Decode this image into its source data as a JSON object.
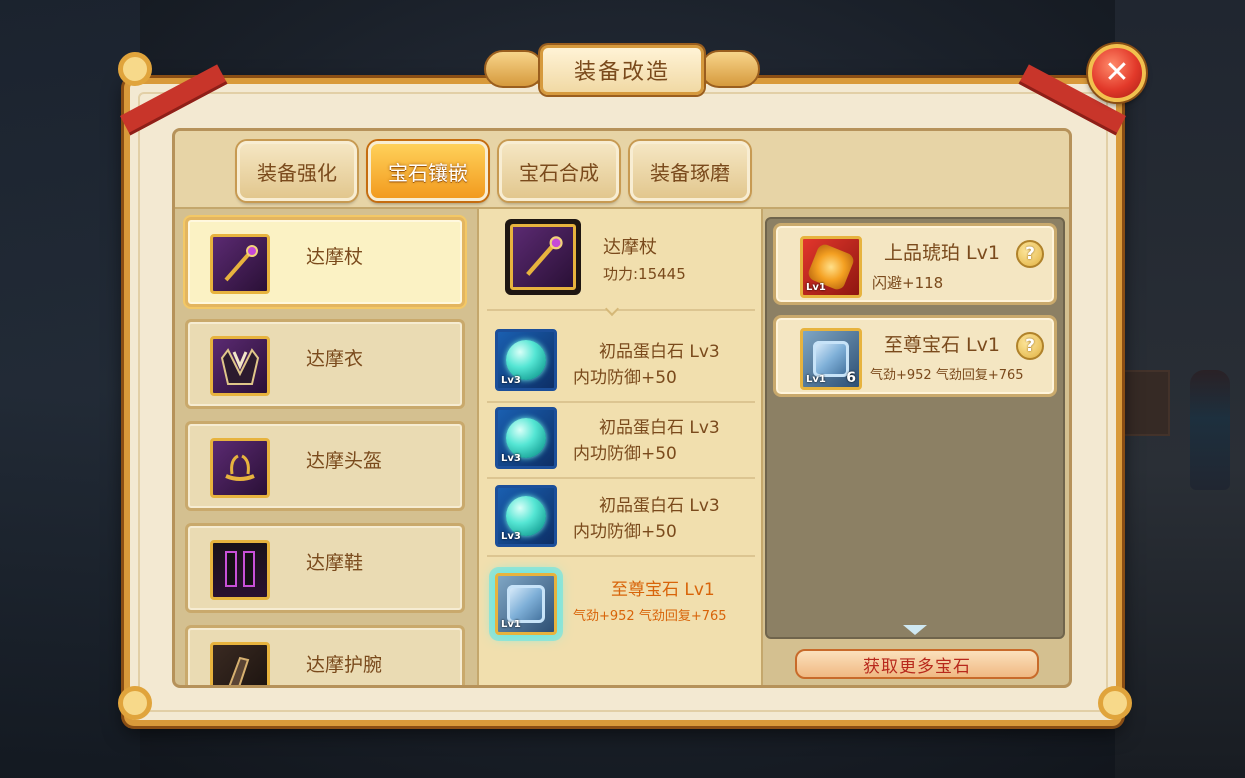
{
  "title": "装备改造",
  "close_label": "✕",
  "tabs": [
    {
      "label": "装备强化",
      "active": false
    },
    {
      "label": "宝石镶嵌",
      "active": true
    },
    {
      "label": "宝石合成",
      "active": false
    },
    {
      "label": "装备琢磨",
      "active": false
    }
  ],
  "equipment_list": [
    {
      "name": "达摩杖",
      "icon": "staff-icon",
      "selected": true
    },
    {
      "name": "达摩衣",
      "icon": "robe-icon",
      "selected": false
    },
    {
      "name": "达摩头盔",
      "icon": "helmet-icon",
      "selected": false
    },
    {
      "name": "达摩鞋",
      "icon": "boots-icon",
      "selected": false
    },
    {
      "name": "达摩护腕",
      "icon": "bracer-icon",
      "selected": false
    }
  ],
  "selected_item": {
    "name": "达摩杖",
    "power": "功力:15445"
  },
  "socketed_gems": [
    {
      "name": "初品蛋白石 Lv3",
      "stat": "内功防御+50",
      "level": "Lv3"
    },
    {
      "name": "初品蛋白石 Lv3",
      "stat": "内功防御+50",
      "level": "Lv3"
    },
    {
      "name": "初品蛋白石 Lv3",
      "stat": "内功防御+50",
      "level": "Lv3"
    },
    {
      "name": "至尊宝石 Lv1",
      "stat": "气劲+952 气劲回复+765",
      "level": "Lv1"
    }
  ],
  "inventory_gems": [
    {
      "name": "上品琥珀 Lv1",
      "stat": "闪避+118",
      "level": "Lv1",
      "count": ""
    },
    {
      "name": "至尊宝石 Lv1",
      "stat": "气劲+952 气劲回复+765",
      "level": "Lv1",
      "count": "6"
    }
  ],
  "help_label": "?",
  "more_gems_button": "获取更多宝石",
  "colors": {
    "accent_orange": "#f29b1e",
    "frame_gold": "#d99a3a",
    "text_brown": "#7a4a1c",
    "highlight_orange": "#d8640a",
    "button_red_text": "#b8291c"
  }
}
